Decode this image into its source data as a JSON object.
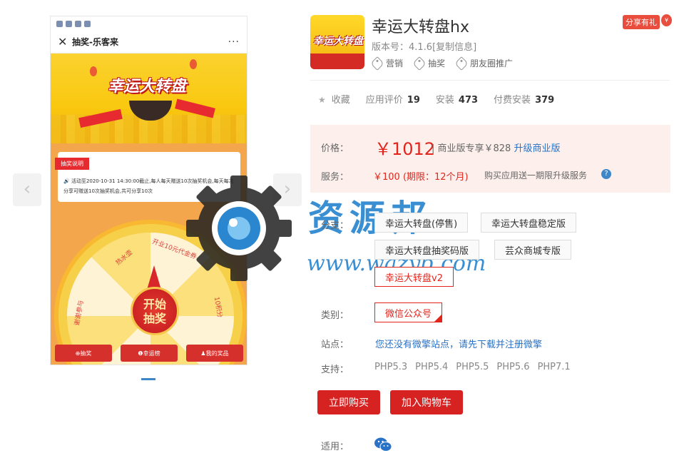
{
  "gallery": {
    "prev_arrow": "‹",
    "next_arrow": "›",
    "phone": {
      "header_close": "✕",
      "header_title": "抽奖-乐客来",
      "header_more": "···",
      "banner_logo": "幸运大转盘",
      "notice_tag": "抽奖说明",
      "notice_text_prefix": "🔊 活动至2020-10-31 14:30:00截止,",
      "notice_text_mid": "每人每天赠送10次抽奖机会,每天每次分享可赠送10次抽奖机会,共可分享10次",
      "wheel_segments": [
        "热水壶",
        "开业10元代金券",
        "10积分",
        "谢谢参与"
      ],
      "start_button_line1": "开始",
      "start_button_line2": "抽奖",
      "bottom_tabs": [
        "⊕抽奖",
        "❶幸运榜",
        "♟我的奖品"
      ]
    }
  },
  "watermark": {
    "text": "资源邦",
    "url": "www.wazyb.com"
  },
  "app": {
    "title": "幸运大转盘hx",
    "icon_text": "幸运大转盘",
    "version": "版本号：4.1.6[复制信息]",
    "tags": [
      "营销",
      "抽奖",
      "朋友圈推广"
    ],
    "share_badge": "分享有礼",
    "share_gift": "¥"
  },
  "stats": {
    "favorite_label": "收藏",
    "rating_label": "应用评价",
    "rating_value": "19",
    "install_label": "安装",
    "install_value": "473",
    "paid_label": "付费安装",
    "paid_value": "379"
  },
  "pricing": {
    "price_label": "价格：",
    "price": "￥1012",
    "business_text": "| 商业版专享￥828",
    "upgrade_link": "升级商业版",
    "service_label": "服务：",
    "service_price": "￥100 (期限：12个月)",
    "service_desc": "购买应用送一期限升级服务",
    "help": "?"
  },
  "branches": {
    "label": "分支：",
    "items": [
      "幸运大转盘(停售)",
      "幸运大转盘稳定版",
      "幸运大转盘抽奖码版",
      "芸众商城专版",
      "幸运大转盘v2"
    ]
  },
  "category": {
    "label": "类别：",
    "value": "微信公众号"
  },
  "site": {
    "label": "站点：",
    "link": "您还没有微擎站点，请先下载并注册微擎"
  },
  "support": {
    "label": "支持：",
    "versions": [
      "PHP5.3",
      "PHP5.4",
      "PHP5.5",
      "PHP5.6",
      "PHP7.1"
    ]
  },
  "actions": {
    "buy": "立即购买",
    "cart": "加入购物车"
  },
  "applicable": {
    "label": "适用："
  },
  "colors": {
    "accent_red": "#d72222",
    "link_blue": "#2a72c6",
    "watermark_blue": "#2a86cf"
  }
}
